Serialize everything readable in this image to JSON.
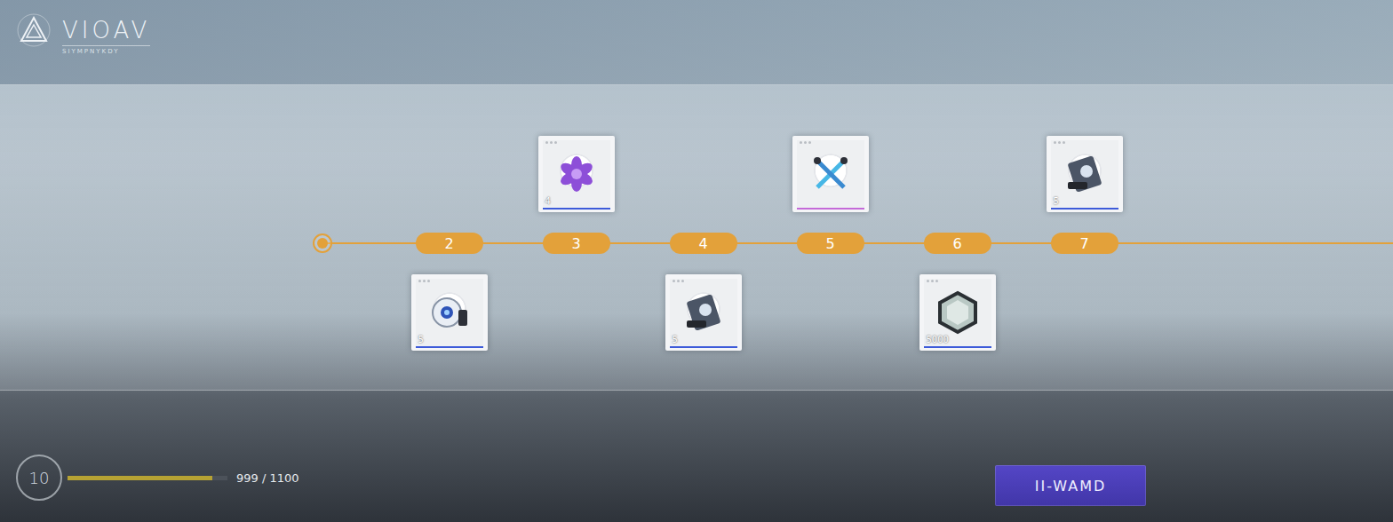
{
  "logo": {
    "title": "VIOAV",
    "subtitle": "SIYMPNYKDY"
  },
  "track": {
    "start_reached": true,
    "levels": [
      {
        "label": "2",
        "reward": {
          "kind": "drone",
          "count": "5",
          "color": "#3d5bd9"
        }
      },
      {
        "label": "3",
        "reward": {
          "kind": "flower",
          "count": "4",
          "color": "#3d5bd9"
        }
      },
      {
        "label": "4",
        "reward": {
          "kind": "chip",
          "count": "5",
          "color": "#3d5bd9"
        }
      },
      {
        "label": "5",
        "reward": {
          "kind": "tools",
          "color": "#c46ad8"
        }
      },
      {
        "label": "6",
        "reward": {
          "kind": "crystal",
          "count": "5000",
          "color": "#3d5bd9"
        }
      },
      {
        "label": "7",
        "reward": {
          "kind": "chip",
          "count": "5",
          "color": "#3d5bd9"
        }
      }
    ]
  },
  "player": {
    "level": "10",
    "exp": "999 / 1100",
    "level_fill": 0.908
  },
  "claim_button": {
    "label": "II-WAMD"
  }
}
